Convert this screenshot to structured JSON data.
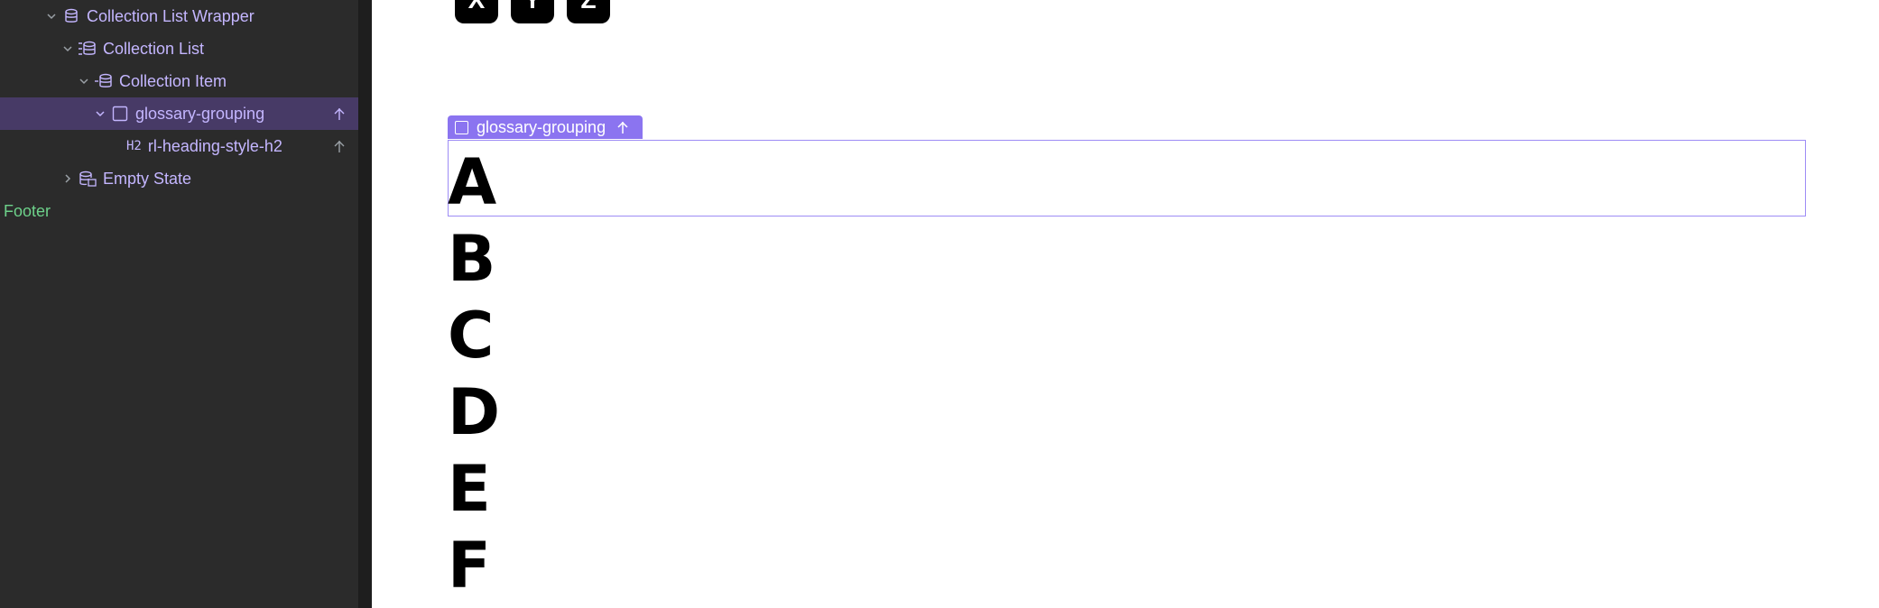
{
  "navigator": {
    "items": [
      {
        "label": "Collection List Wrapper",
        "icon": "database-icon"
      },
      {
        "label": "Collection List",
        "icon": "collection-list-icon"
      },
      {
        "label": "Collection Item",
        "icon": "collection-item-icon"
      },
      {
        "label": "glossary-grouping",
        "icon": "div-block-icon",
        "selected": true
      },
      {
        "label": "rl-heading-style-h2",
        "tag": "H2"
      },
      {
        "label": "Empty State",
        "icon": "empty-state-icon"
      },
      {
        "label": "Footer"
      }
    ]
  },
  "canvas": {
    "keys": [
      "X",
      "Y",
      "Z"
    ],
    "selection_label": "glossary-grouping",
    "letters": [
      "A",
      "B",
      "C",
      "D",
      "E",
      "F"
    ]
  },
  "colors": {
    "navigator_bg": "#2b2b2b",
    "selected_row": "#473a66",
    "component_text": "#c4b6ff",
    "footer_text": "#6dd18a",
    "selection_accent": "#8b74f0"
  }
}
